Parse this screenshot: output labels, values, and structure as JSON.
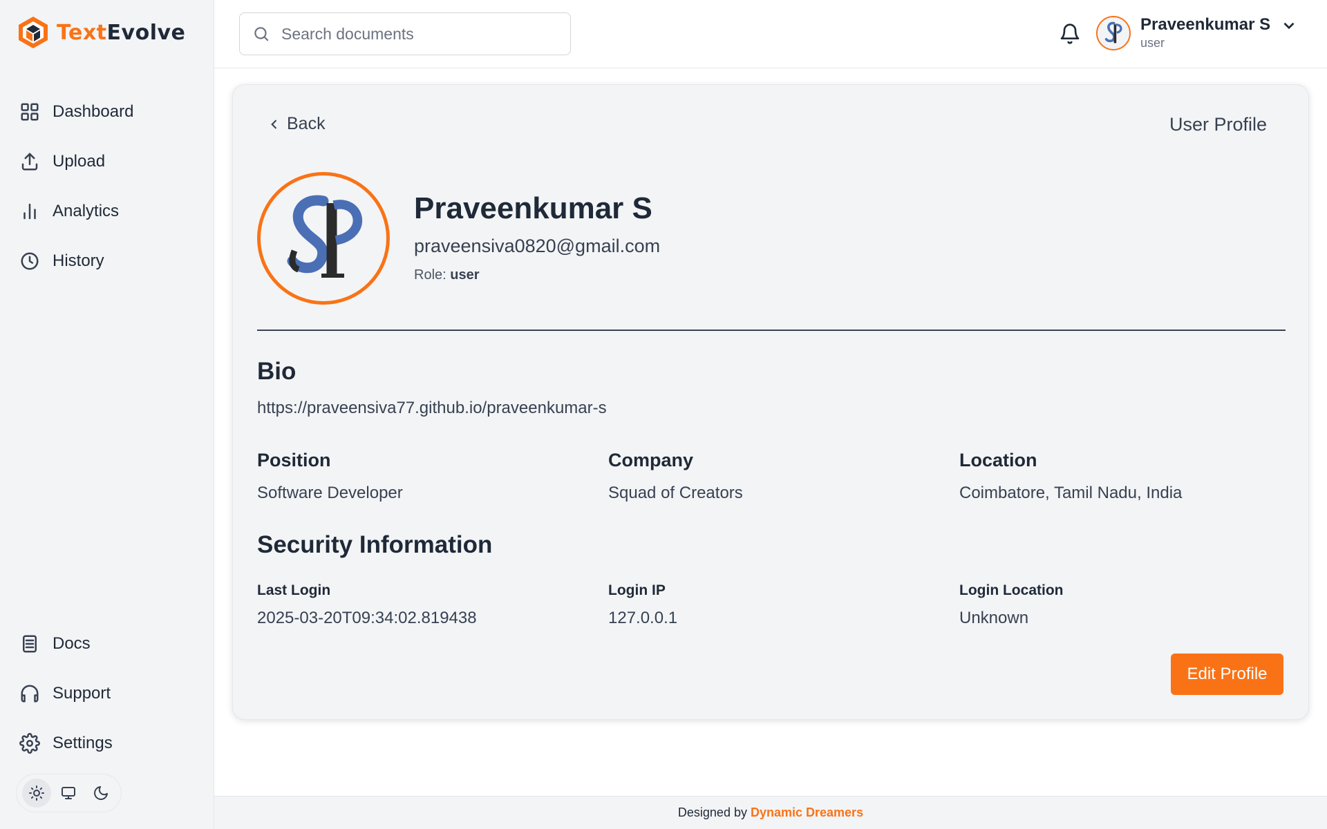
{
  "app": {
    "name_part1": "Text",
    "name_part2": "Evolve"
  },
  "sidebar": {
    "top_items": [
      {
        "label": "Dashboard",
        "icon": "grid-icon"
      },
      {
        "label": "Upload",
        "icon": "upload-icon"
      },
      {
        "label": "Analytics",
        "icon": "bar-chart-icon"
      },
      {
        "label": "History",
        "icon": "clock-icon"
      }
    ],
    "bottom_items": [
      {
        "label": "Docs",
        "icon": "document-icon"
      },
      {
        "label": "Support",
        "icon": "headphones-icon"
      },
      {
        "label": "Settings",
        "icon": "gear-icon"
      }
    ],
    "theme_options": [
      "light",
      "system",
      "dark"
    ],
    "theme_selected": "light"
  },
  "header": {
    "search_placeholder": "Search documents",
    "user_name": "Praveenkumar S",
    "user_role": "user"
  },
  "profile": {
    "back_label": "Back",
    "page_title": "User Profile",
    "name": "Praveenkumar S",
    "email": "praveensiva0820@gmail.com",
    "role_label": "Role:",
    "role_value": "user",
    "bio_heading": "Bio",
    "bio_text": "https://praveensiva77.github.io/praveenkumar-s",
    "details": [
      {
        "label": "Position",
        "value": "Software Developer"
      },
      {
        "label": "Company",
        "value": "Squad of Creators"
      },
      {
        "label": "Location",
        "value": "Coimbatore, Tamil Nadu, India"
      }
    ],
    "security_heading": "Security Information",
    "security": [
      {
        "label": "Last Login",
        "value": "2025-03-20T09:34:02.819438"
      },
      {
        "label": "Login IP",
        "value": "127.0.0.1"
      },
      {
        "label": "Login Location",
        "value": "Unknown"
      }
    ],
    "edit_label": "Edit Profile"
  },
  "footer": {
    "prefix": "Designed by",
    "brand": "Dynamic Dreamers"
  },
  "colors": {
    "accent": "#f97316",
    "text": "#1f2937",
    "sidebar_bg": "#f3f4f6"
  }
}
